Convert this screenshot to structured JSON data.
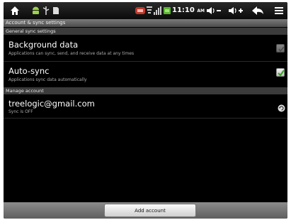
{
  "status_bar": {
    "time": "11:10",
    "ampm": "AM",
    "icons": [
      "home-icon",
      "android-icon",
      "usb-icon",
      "sd-card-icon",
      "warning-icon",
      "wifi-icon",
      "signal-icon",
      "battery-icon",
      "volume-down-icon",
      "volume-up-icon",
      "back-icon",
      "menu-icon"
    ]
  },
  "title_bar": {
    "title": "Account & sync settings"
  },
  "general_section": {
    "header": "General sync settings"
  },
  "background_data": {
    "title": "Background data",
    "subtitle": "Applications can sync, send, and receive data at any times",
    "checked": false
  },
  "auto_sync": {
    "title": "Auto-sync",
    "subtitle": "Applications sync data automatically",
    "checked": true
  },
  "manage_section": {
    "header": "Manage account"
  },
  "account": {
    "email": "treelogic@gmail.com",
    "status": "Sync is OFF"
  },
  "bottom_bar": {
    "add_account_label": "Add account"
  },
  "colors": {
    "check_green": "#3fa32b",
    "background": "#000000"
  }
}
